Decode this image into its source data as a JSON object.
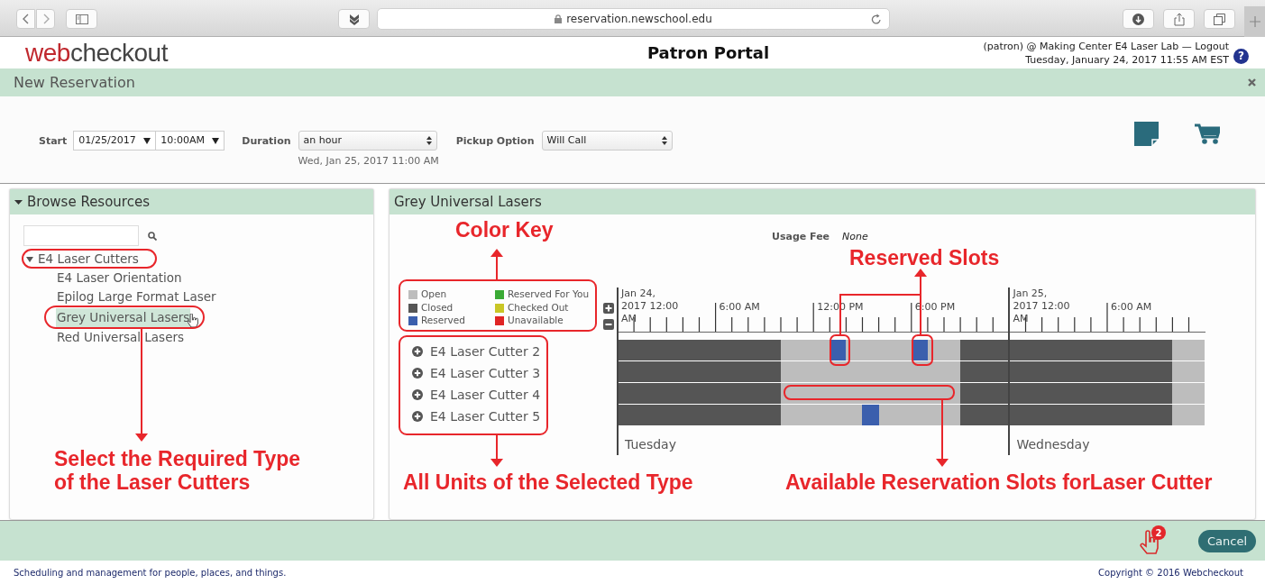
{
  "browser": {
    "address": "reservation.newschool.edu"
  },
  "header": {
    "logo": {
      "accent": "web",
      "rest": "checkout"
    },
    "title": "Patron Portal",
    "user_line": "(patron) @ Making Center E4 Laser Lab — ",
    "logout_link": "Logout",
    "datetime": "Tuesday, January 24, 2017 11:55 AM EST",
    "help_glyph": "?"
  },
  "dialog": {
    "title": "New Reservation"
  },
  "form": {
    "start_label": "Start",
    "date": "01/25/2017",
    "time": "10:00AM",
    "duration_label": "Duration",
    "duration": "an hour",
    "end_time": "Wed, Jan 25, 2017 11:00 AM",
    "pickup_label": "Pickup Option",
    "pickup": "Will Call"
  },
  "browse": {
    "title": "Browse Resources",
    "expanded": true,
    "tree": [
      {
        "label": "E4 Laser Cutters",
        "expanded": true,
        "selected": false,
        "children": [
          {
            "label": "E4 Laser Orientation",
            "selected": false
          },
          {
            "label": "Epilog Large Format Laser",
            "selected": false
          },
          {
            "label": "Grey Universal Lasers",
            "selected": true
          },
          {
            "label": "Red Universal Lasers",
            "selected": false
          }
        ]
      }
    ]
  },
  "resource": {
    "title": "Grey Universal Lasers",
    "usage_fee_label": "Usage Fee",
    "usage_fee": "None",
    "legend": [
      {
        "label": "Open",
        "color": "#bdbdbd"
      },
      {
        "label": "Closed",
        "color": "#555555"
      },
      {
        "label": "Reserved",
        "color": "#3b5fad"
      },
      {
        "label": "Reserved For You",
        "color": "#3aaa35"
      },
      {
        "label": "Checked Out",
        "color": "#c9c626"
      },
      {
        "label": "Unavailable",
        "color": "#e02424"
      }
    ],
    "axis_labels": [
      "Jan 24, 2017 12:00 AM",
      "6:00 AM",
      "12:00 PM",
      "6:00 PM",
      "Jan 25, 2017 12:00 AM",
      "6:00 AM"
    ],
    "day_labels": [
      "Tuesday",
      "Wednesday"
    ],
    "units": [
      {
        "label": "E4 Laser Cutter 2",
        "slots": [
          {
            "kind": "closed"
          },
          {
            "kind": "closed"
          },
          {
            "kind": "closed"
          },
          {
            "kind": "closed"
          },
          {
            "kind": "closed"
          },
          {
            "kind": "closed"
          },
          {
            "kind": "closed"
          },
          {
            "kind": "closed"
          },
          {
            "kind": "closed"
          },
          {
            "kind": "closed"
          },
          {
            "kind": "open"
          },
          {
            "kind": "open"
          },
          {
            "kind": "open"
          },
          {
            "kind": "reserved"
          },
          {
            "kind": "open"
          },
          {
            "kind": "open"
          },
          {
            "kind": "open"
          },
          {
            "kind": "open"
          },
          {
            "kind": "reserved"
          },
          {
            "kind": "open"
          },
          {
            "kind": "open"
          },
          {
            "kind": "closed"
          },
          {
            "kind": "closed"
          },
          {
            "kind": "closed"
          },
          {
            "kind": "closed"
          },
          {
            "kind": "closed"
          },
          {
            "kind": "closed"
          },
          {
            "kind": "closed"
          },
          {
            "kind": "closed"
          },
          {
            "kind": "closed"
          },
          {
            "kind": "closed"
          },
          {
            "kind": "closed"
          },
          {
            "kind": "closed"
          },
          {
            "kind": "closed"
          },
          {
            "kind": "open"
          },
          {
            "kind": "open"
          }
        ]
      },
      {
        "label": "E4 Laser Cutter 3",
        "slots": [
          {
            "kind": "closed"
          },
          {
            "kind": "closed"
          },
          {
            "kind": "closed"
          },
          {
            "kind": "closed"
          },
          {
            "kind": "closed"
          },
          {
            "kind": "closed"
          },
          {
            "kind": "closed"
          },
          {
            "kind": "closed"
          },
          {
            "kind": "closed"
          },
          {
            "kind": "closed"
          },
          {
            "kind": "open"
          },
          {
            "kind": "open"
          },
          {
            "kind": "open"
          },
          {
            "kind": "open"
          },
          {
            "kind": "open"
          },
          {
            "kind": "open"
          },
          {
            "kind": "open"
          },
          {
            "kind": "open"
          },
          {
            "kind": "open"
          },
          {
            "kind": "open"
          },
          {
            "kind": "open"
          },
          {
            "kind": "closed"
          },
          {
            "kind": "closed"
          },
          {
            "kind": "closed"
          },
          {
            "kind": "closed"
          },
          {
            "kind": "closed"
          },
          {
            "kind": "closed"
          },
          {
            "kind": "closed"
          },
          {
            "kind": "closed"
          },
          {
            "kind": "closed"
          },
          {
            "kind": "closed"
          },
          {
            "kind": "closed"
          },
          {
            "kind": "closed"
          },
          {
            "kind": "closed"
          },
          {
            "kind": "open"
          },
          {
            "kind": "open"
          }
        ]
      },
      {
        "label": "E4 Laser Cutter 4",
        "slots": [
          {
            "kind": "closed"
          },
          {
            "kind": "closed"
          },
          {
            "kind": "closed"
          },
          {
            "kind": "closed"
          },
          {
            "kind": "closed"
          },
          {
            "kind": "closed"
          },
          {
            "kind": "closed"
          },
          {
            "kind": "closed"
          },
          {
            "kind": "closed"
          },
          {
            "kind": "closed"
          },
          {
            "kind": "open"
          },
          {
            "kind": "open"
          },
          {
            "kind": "open"
          },
          {
            "kind": "open"
          },
          {
            "kind": "open"
          },
          {
            "kind": "open"
          },
          {
            "kind": "open"
          },
          {
            "kind": "open"
          },
          {
            "kind": "open"
          },
          {
            "kind": "open"
          },
          {
            "kind": "open"
          },
          {
            "kind": "closed"
          },
          {
            "kind": "closed"
          },
          {
            "kind": "closed"
          },
          {
            "kind": "closed"
          },
          {
            "kind": "closed"
          },
          {
            "kind": "closed"
          },
          {
            "kind": "closed"
          },
          {
            "kind": "closed"
          },
          {
            "kind": "closed"
          },
          {
            "kind": "closed"
          },
          {
            "kind": "closed"
          },
          {
            "kind": "closed"
          },
          {
            "kind": "closed"
          },
          {
            "kind": "open"
          },
          {
            "kind": "open"
          }
        ]
      },
      {
        "label": "E4 Laser Cutter 5",
        "slots": [
          {
            "kind": "closed"
          },
          {
            "kind": "closed"
          },
          {
            "kind": "closed"
          },
          {
            "kind": "closed"
          },
          {
            "kind": "closed"
          },
          {
            "kind": "closed"
          },
          {
            "kind": "closed"
          },
          {
            "kind": "closed"
          },
          {
            "kind": "closed"
          },
          {
            "kind": "closed"
          },
          {
            "kind": "open"
          },
          {
            "kind": "open"
          },
          {
            "kind": "open"
          },
          {
            "kind": "open"
          },
          {
            "kind": "open"
          },
          {
            "kind": "reserved"
          },
          {
            "kind": "open"
          },
          {
            "kind": "open"
          },
          {
            "kind": "open"
          },
          {
            "kind": "open"
          },
          {
            "kind": "open"
          },
          {
            "kind": "closed"
          },
          {
            "kind": "closed"
          },
          {
            "kind": "closed"
          },
          {
            "kind": "closed"
          },
          {
            "kind": "closed"
          },
          {
            "kind": "closed"
          },
          {
            "kind": "closed"
          },
          {
            "kind": "closed"
          },
          {
            "kind": "closed"
          },
          {
            "kind": "closed"
          },
          {
            "kind": "closed"
          },
          {
            "kind": "closed"
          },
          {
            "kind": "closed"
          },
          {
            "kind": "open"
          },
          {
            "kind": "open"
          }
        ]
      }
    ]
  },
  "footer": {
    "badge": "2",
    "cancel": "Cancel",
    "tagline": "Scheduling and management for people, places, and things.",
    "copyright": "Copyright © 2016 Webcheckout"
  },
  "annotations": [
    {
      "text": "Color Key"
    },
    {
      "text": "Reserved Slots"
    },
    {
      "text": "Select the Required Type of the Laser Cutters"
    },
    {
      "text": "All Units of the Selected Type"
    },
    {
      "text": "Available Reservation Slots forLaser Cutter"
    }
  ]
}
